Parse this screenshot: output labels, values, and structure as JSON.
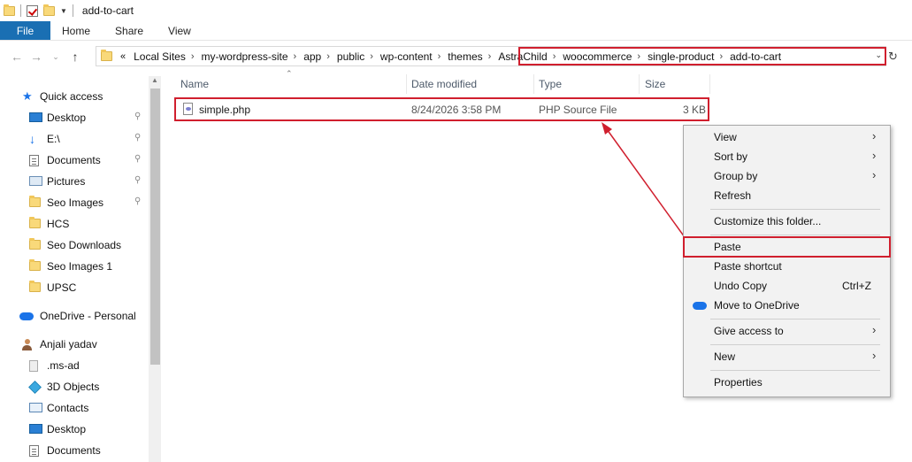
{
  "window": {
    "title": "add-to-cart"
  },
  "ribbon": {
    "tabs": [
      "File",
      "Home",
      "Share",
      "View"
    ]
  },
  "address": {
    "overflow": "«",
    "crumbs": [
      "Local Sites",
      "my-wordpress-site",
      "app",
      "public",
      "wp-content",
      "themes",
      "AstraChild",
      "woocommerce",
      "single-product",
      "add-to-cart"
    ]
  },
  "sidebar": {
    "quick_access": "Quick access",
    "items": [
      "Desktop",
      "E:\\",
      "Documents",
      "Pictures",
      "Seo Images",
      "HCS",
      "Seo Downloads",
      "Seo Images 1",
      "UPSC"
    ],
    "onedrive": "OneDrive - Personal",
    "user": "Anjali yadav",
    "user_items": [
      ".ms-ad",
      "3D Objects",
      "Contacts",
      "Desktop",
      "Documents"
    ]
  },
  "columns": [
    "Name",
    "Date modified",
    "Type",
    "Size"
  ],
  "files": [
    {
      "name": "simple.php",
      "date": "8/24/2026 3:58 PM",
      "type": "PHP Source File",
      "size": "3 KB"
    }
  ],
  "context_menu": {
    "items": [
      {
        "label": "View",
        "submenu": true
      },
      {
        "label": "Sort by",
        "submenu": true
      },
      {
        "label": "Group by",
        "submenu": true
      },
      {
        "label": "Refresh"
      },
      {
        "label": "Customize this folder..."
      },
      {
        "label": "Paste"
      },
      {
        "label": "Paste shortcut"
      },
      {
        "label": "Undo Copy",
        "shortcut": "Ctrl+Z"
      },
      {
        "label": "Move to OneDrive",
        "icon": "onedrive-icon"
      },
      {
        "label": "Give access to",
        "submenu": true
      },
      {
        "label": "New",
        "submenu": true
      },
      {
        "label": "Properties"
      }
    ]
  },
  "colors": {
    "accent": "#1a6fb3",
    "highlight": "#d01f2e"
  }
}
